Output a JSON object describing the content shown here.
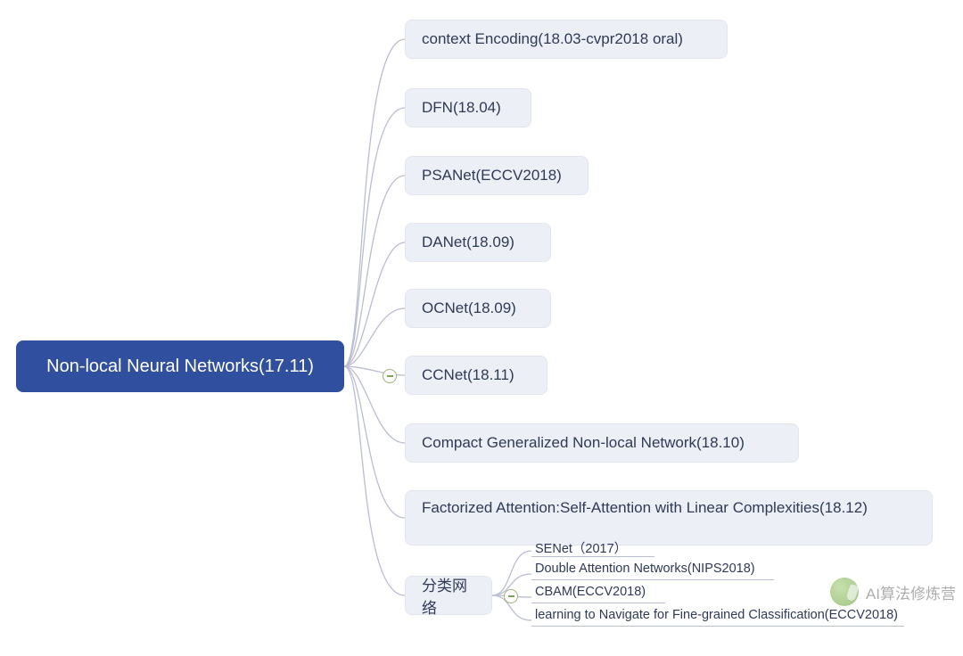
{
  "root": {
    "label": "Non-local Neural Networks(17.11)"
  },
  "children": [
    {
      "label": "context Encoding(18.03-cvpr2018 oral)"
    },
    {
      "label": "DFN(18.04)"
    },
    {
      "label": "PSANet(ECCV2018)"
    },
    {
      "label": "DANet(18.09)"
    },
    {
      "label": "OCNet(18.09)"
    },
    {
      "label": "CCNet(18.11)"
    },
    {
      "label": "Compact Generalized Non-local Network(18.10)"
    },
    {
      "label": "Factorized Attention:Self-Attention with Linear Complexities(18.12)"
    },
    {
      "label": "分类网络"
    }
  ],
  "classification_leaves": [
    {
      "label": "SENet（2017）"
    },
    {
      "label": "Double Attention Networks(NIPS2018)"
    },
    {
      "label": "CBAM(ECCV2018)"
    },
    {
      "label": "learning to Navigate for Fine-grained Classification(ECCV2018)"
    }
  ],
  "watermark": {
    "text": "AI算法修炼营",
    "logo_name": "wechat-logo"
  }
}
